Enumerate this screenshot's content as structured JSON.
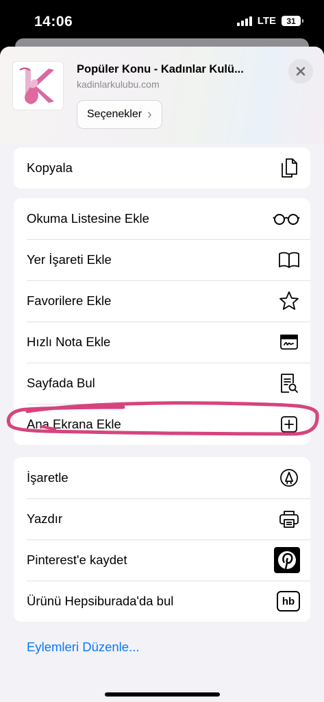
{
  "status_bar": {
    "time": "14:06",
    "network": "LTE",
    "battery": "31"
  },
  "sheet": {
    "title": "Popüler Konu - Kadınlar Kulü...",
    "url": "kadinlarkulubu.com",
    "options_label": "Seçenekler",
    "options_chevron": "›",
    "close_icon": "close-icon"
  },
  "group1": [
    {
      "label": "Kopyala",
      "icon": "copy-icon"
    }
  ],
  "group2": [
    {
      "label": "Okuma Listesine Ekle",
      "icon": "glasses-icon"
    },
    {
      "label": "Yer İşareti Ekle",
      "icon": "book-icon"
    },
    {
      "label": "Favorilere Ekle",
      "icon": "star-icon"
    },
    {
      "label": "Hızlı Nota Ekle",
      "icon": "quick-note-icon"
    },
    {
      "label": "Sayfada Bul",
      "icon": "find-in-page-icon"
    },
    {
      "label": "Ana Ekrana Ekle",
      "icon": "add-square-icon"
    }
  ],
  "group3": [
    {
      "label": "İşaretle",
      "icon": "markup-icon"
    },
    {
      "label": "Yazdır",
      "icon": "printer-icon"
    },
    {
      "label": "Pinterest'e kaydet",
      "icon": "pinterest-icon"
    },
    {
      "label": "Ürünü Hepsiburada'da bul",
      "icon": "hepsiburada-icon",
      "icon_text": "hb"
    }
  ],
  "edit_actions": "Eylemleri Düzenle...",
  "colors": {
    "accent": "#0a7aff",
    "annotation": "#d6447e",
    "sheet_bg": "#f2f2f7"
  }
}
